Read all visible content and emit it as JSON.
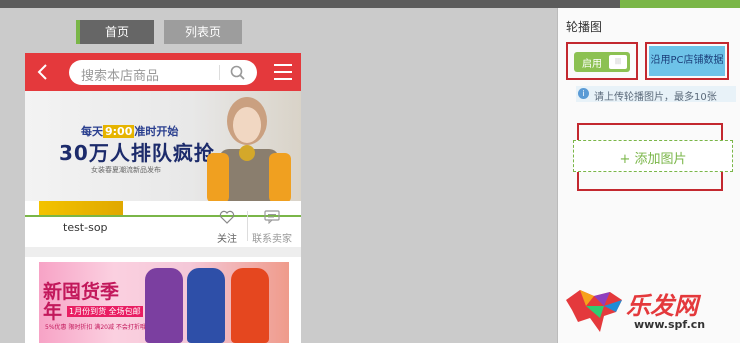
{
  "tabs": [
    {
      "label": "首页"
    },
    {
      "label": "列表页"
    }
  ],
  "phone": {
    "search_placeholder": "搜索本店商品",
    "banner": {
      "line1_prefix": "每天",
      "line1_time": "9:00",
      "line1_suffix": "准时开始",
      "headline": "30万人排队疯抢",
      "subline": "女装春夏潮流新品发布"
    },
    "store": {
      "name": "test-sop",
      "follow_label": "关注",
      "contact_label": "联系卖家"
    },
    "promo": {
      "title": "新囤货季",
      "title_line2": "年",
      "sub": "1月份到货 全场包邮",
      "tags": "5%优惠 限时折扣 满20减 不会打折哦"
    }
  },
  "panel": {
    "title": "轮播图",
    "toggle_label": "启用",
    "pc_button": "沿用PC店铺数据",
    "info": "请上传轮播图片，最多10张",
    "add_label": "+ 添加图片"
  },
  "watermark": {
    "text": "乐发网",
    "url": "www.spf.cn"
  },
  "colors": {
    "header_red": "#e4393c",
    "accent_green": "#7ab648",
    "highlight_red": "#c3282f"
  }
}
